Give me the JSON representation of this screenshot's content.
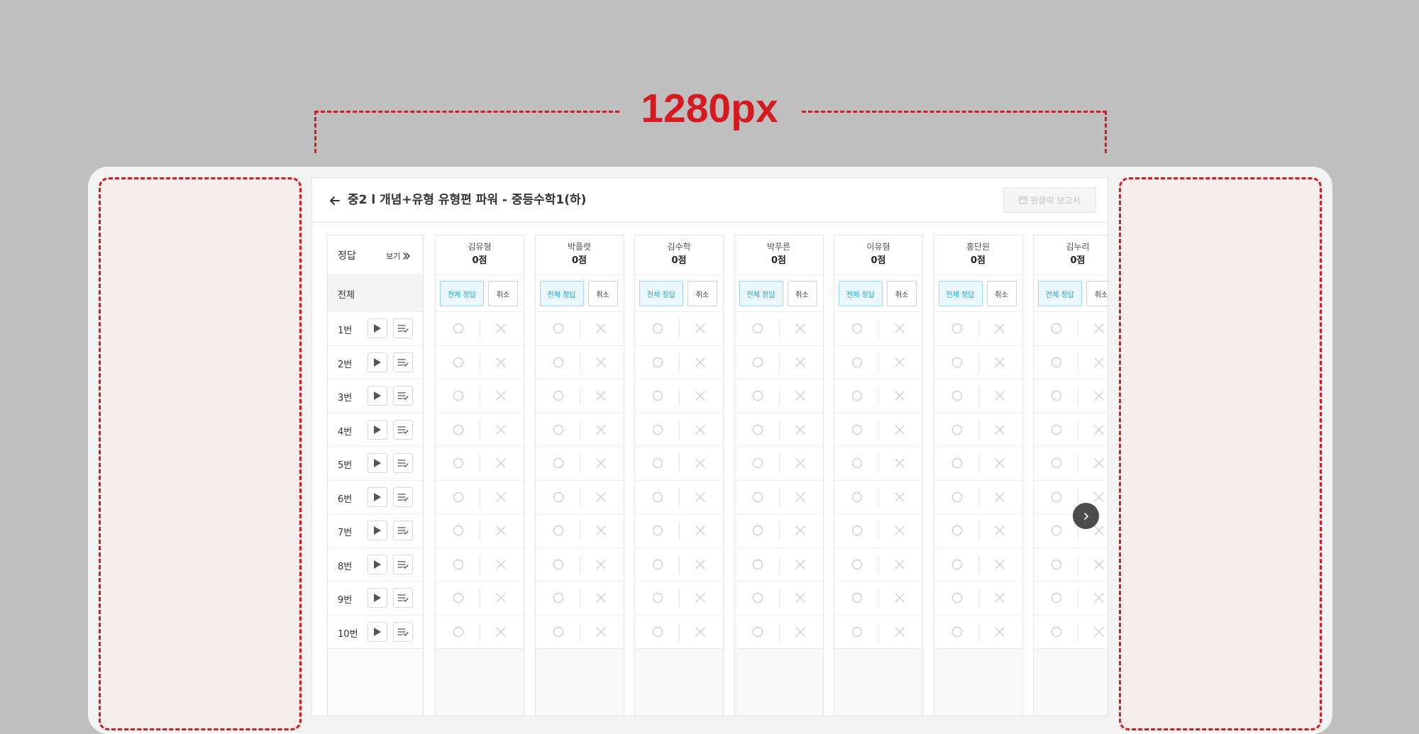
{
  "annotation": {
    "width_label": "1280px"
  },
  "header": {
    "title": "중2 l 개념+유형 유형편 파워 - 중등수학1(하)",
    "report_button": "원클릭 보고서"
  },
  "answer_column": {
    "label": "정답",
    "view_label": "보기",
    "all_label": "전체",
    "questions": [
      "1번",
      "2번",
      "3번",
      "4번",
      "5번",
      "6번",
      "7번",
      "8번",
      "9번",
      "10번"
    ]
  },
  "students": [
    {
      "name": "김유형",
      "score": "0점"
    },
    {
      "name": "박플랫",
      "score": "0점"
    },
    {
      "name": "김수학",
      "score": "0점"
    },
    {
      "name": "박푸른",
      "score": "0점"
    },
    {
      "name": "이유형",
      "score": "0점"
    },
    {
      "name": "홍단원",
      "score": "0점"
    },
    {
      "name": "김누리",
      "score": "0점"
    }
  ],
  "student_actions": {
    "all_correct": "전체 정답",
    "cancel": "취소"
  },
  "icons": [
    "back-arrow-icon",
    "report-icon",
    "double-chevron-right-icon",
    "play-icon",
    "checklist-icon",
    "circle-o-icon",
    "x-mark-icon",
    "chevron-right-icon"
  ],
  "colors": {
    "annotation_red": "#d71920",
    "accent_blue": "#1aa7e3"
  }
}
